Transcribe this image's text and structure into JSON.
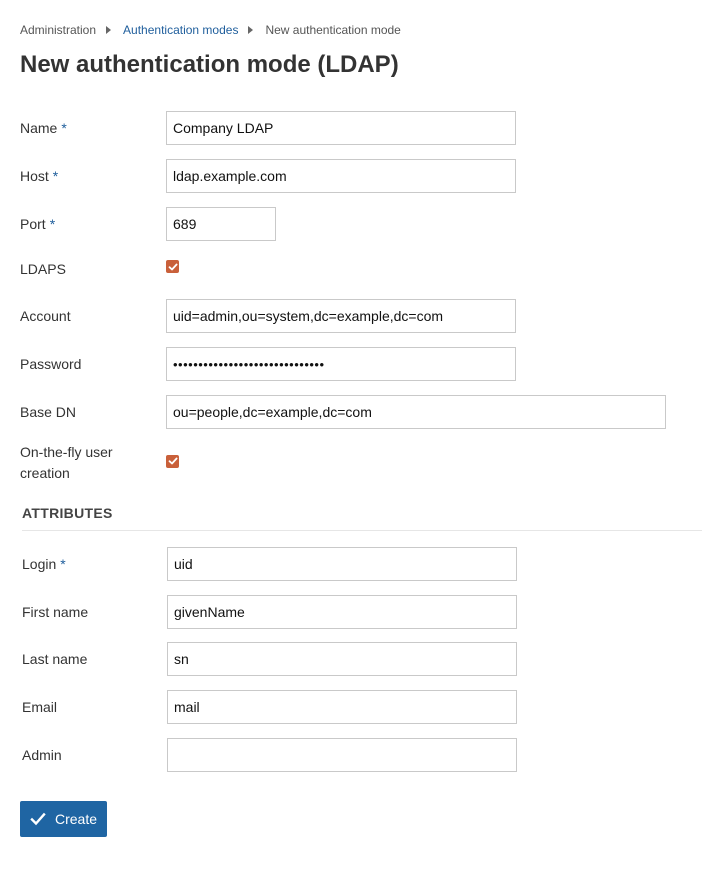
{
  "breadcrumb": [
    {
      "label": "Administration",
      "link": false
    },
    {
      "label": "Authentication modes",
      "link": true
    },
    {
      "label": "New authentication mode",
      "link": false
    }
  ],
  "page_title": "New authentication mode (LDAP)",
  "required_marker": "*",
  "form": {
    "name": {
      "label": "Name",
      "value": "Company LDAP",
      "required": true
    },
    "host": {
      "label": "Host",
      "value": "ldap.example.com",
      "required": true
    },
    "port": {
      "label": "Port",
      "value": "689",
      "required": true
    },
    "ldaps": {
      "label": "LDAPS",
      "checked": true
    },
    "account": {
      "label": "Account",
      "value": "uid=admin,ou=system,dc=example,dc=com"
    },
    "password": {
      "label": "Password",
      "value": "••••••••••••••••••••••••••••••",
      "masked_length": 30
    },
    "base_dn": {
      "label": "Base DN",
      "value": "ou=people,dc=example,dc=com"
    },
    "onthefly": {
      "label_line1": "On-the-fly user",
      "label_line2": "creation",
      "checked": true
    }
  },
  "attributes": {
    "title": "ATTRIBUTES",
    "login": {
      "label": "Login",
      "value": "uid",
      "required": true
    },
    "firstname": {
      "label": "First name",
      "value": "givenName"
    },
    "lastname": {
      "label": "Last name",
      "value": "sn"
    },
    "email": {
      "label": "Email",
      "value": "mail"
    },
    "admin": {
      "label": "Admin",
      "value": ""
    }
  },
  "actions": {
    "create_label": "Create",
    "create_icon": "checkmark-icon"
  },
  "colors": {
    "accent": "#1f65a3",
    "link": "#1f5e9c",
    "checkbox": "#c9603a"
  }
}
